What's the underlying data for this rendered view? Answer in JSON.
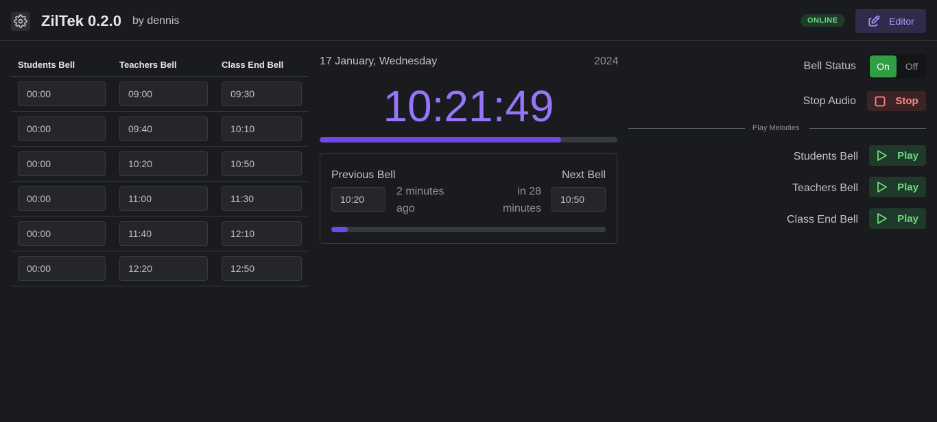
{
  "header": {
    "title": "ZilTek 0.2.0",
    "author": "by dennis",
    "status": "ONLINE",
    "editor_label": "Editor"
  },
  "bells": {
    "headers": [
      "Students Bell",
      "Teachers Bell",
      "Class End Bell"
    ],
    "rows": [
      [
        "00:00",
        "09:00",
        "09:30"
      ],
      [
        "00:00",
        "09:40",
        "10:10"
      ],
      [
        "00:00",
        "10:20",
        "10:50"
      ],
      [
        "00:00",
        "11:00",
        "11:30"
      ],
      [
        "00:00",
        "11:40",
        "12:10"
      ],
      [
        "00:00",
        "12:20",
        "12:50"
      ]
    ]
  },
  "clock": {
    "date": "17 January, Wednesday",
    "year": "2024",
    "time": "10:21:49",
    "day_progress": 0.81
  },
  "bell_card": {
    "previous_label": "Previous Bell",
    "next_label": "Next Bell",
    "previous_time": "10:20",
    "next_time": "10:50",
    "previous_relative": "2 minutes ago",
    "next_relative": "in 28 minutes",
    "progress": 0.06
  },
  "controls": {
    "bell_status_label": "Bell Status",
    "toggle_on": "On",
    "toggle_off": "Off",
    "stop_audio_label": "Stop Audio",
    "stop_label": "Stop",
    "play_melodies_label": "Play Melodies",
    "melodies": [
      {
        "label": "Students Bell",
        "button": "Play"
      },
      {
        "label": "Teachers Bell",
        "button": "Play"
      },
      {
        "label": "Class End Bell",
        "button": "Play"
      }
    ]
  },
  "colors": {
    "accent": "#9775fa",
    "progress": "#7048e8",
    "online": "#69db7c",
    "stop": "#ff8787"
  }
}
